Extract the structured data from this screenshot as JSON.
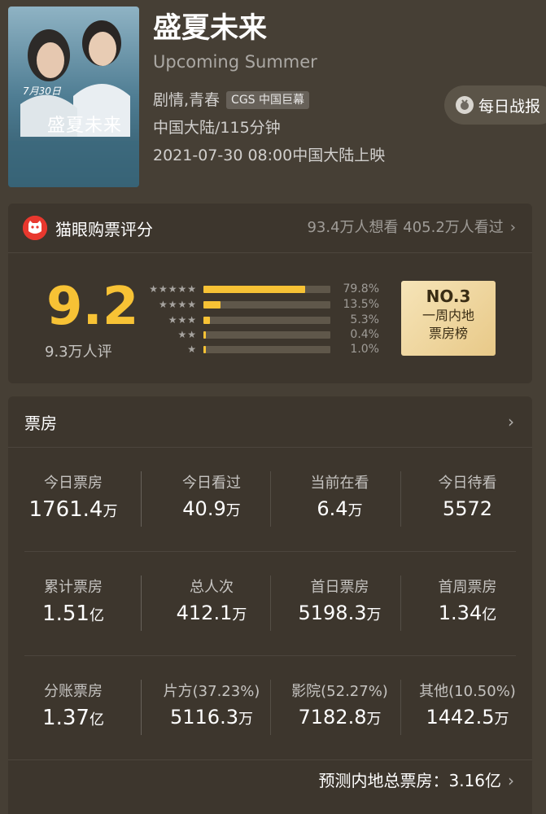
{
  "movie": {
    "title": "盛夏未来",
    "english_title": "Upcoming Summer",
    "genre": "剧情,青春",
    "format_badge": "CGS 中国巨幕",
    "region_duration": "中国大陆/115分钟",
    "release": "2021-07-30 08:00中国大陆上映",
    "poster_text": "盛夏未来",
    "poster_date_text": "7月30日"
  },
  "daily_report": {
    "label": "每日战报",
    "icon": "medal-icon"
  },
  "rating": {
    "source": "猫眼购票评分",
    "want_watched": "93.4万人想看 405.2万人看过",
    "score": "9.2",
    "count": "9.3万人评",
    "distribution": [
      {
        "stars": 5,
        "percent": 79.8,
        "label": "79.8%"
      },
      {
        "stars": 4,
        "percent": 13.5,
        "label": "13.5%"
      },
      {
        "stars": 3,
        "percent": 5.3,
        "label": "5.3%"
      },
      {
        "stars": 2,
        "percent": 0.4,
        "label": "0.4%"
      },
      {
        "stars": 1,
        "percent": 1.0,
        "label": "1.0%"
      }
    ],
    "rank_no": "NO.3",
    "rank_desc_1": "一周内地",
    "rank_desc_2": "票房榜",
    "accent": "#f7c235"
  },
  "boxoffice": {
    "title": "票房",
    "rows": [
      [
        {
          "label": "今日票房",
          "value": "1761.4",
          "unit": "万"
        },
        {
          "label": "今日看过",
          "value": "40.9",
          "unit": "万"
        },
        {
          "label": "当前在看",
          "value": "6.4",
          "unit": "万"
        },
        {
          "label": "今日待看",
          "value": "5572",
          "unit": ""
        }
      ],
      [
        {
          "label": "累计票房",
          "value": "1.51",
          "unit": "亿"
        },
        {
          "label": "总人次",
          "value": "412.1",
          "unit": "万"
        },
        {
          "label": "首日票房",
          "value": "5198.3",
          "unit": "万"
        },
        {
          "label": "首周票房",
          "value": "1.34",
          "unit": "亿"
        }
      ],
      [
        {
          "label": "分账票房",
          "value": "1.37",
          "unit": "亿"
        },
        {
          "label": "片方(37.23%)",
          "value": "5116.3",
          "unit": "万"
        },
        {
          "label": "影院(52.27%)",
          "value": "7182.8",
          "unit": "万"
        },
        {
          "label": "其他(10.50%)",
          "value": "1442.5",
          "unit": "万"
        }
      ]
    ],
    "prediction": "预测内地总票房：3.16亿"
  }
}
